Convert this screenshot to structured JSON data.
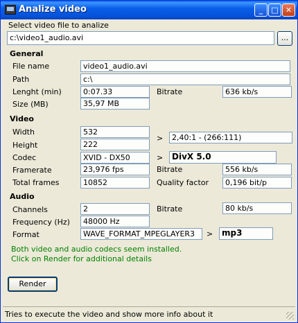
{
  "window": {
    "title": "Analize video",
    "buttons": {
      "minimize": "_",
      "maximize": "□",
      "close": "✕"
    }
  },
  "select": {
    "label": "Select video file to analize",
    "value": "c:\\video1_audio.avi",
    "browse_label": "..."
  },
  "general": {
    "header": "General",
    "file_name_label": "File name",
    "file_name": "video1_audio.avi",
    "path_label": "Path",
    "path": "c:\\",
    "length_label": "Lenght (min)",
    "length": "0:07.33",
    "bitrate_label": "Bitrate",
    "bitrate": "636 kb/s",
    "size_label": "Size (MB)",
    "size": "35,97 MB"
  },
  "video": {
    "header": "Video",
    "width_label": "Width",
    "width": "532",
    "height_label": "Height",
    "height": "222",
    "aspect_arrow": ">",
    "aspect": "2,40:1 - (266:111)",
    "codec_label": "Codec",
    "codec": "XVID - DX50",
    "codec_arrow": ">",
    "codec_name": "DivX 5.0",
    "framerate_label": "Framerate",
    "framerate": "23,976 fps",
    "bitrate_label": "Bitrate",
    "bitrate": "556 kb/s",
    "total_frames_label": "Total frames",
    "total_frames": "10852",
    "quality_label": "Quality factor",
    "quality": "0,196 bit/p"
  },
  "audio": {
    "header": "Audio",
    "channels_label": "Channels",
    "channels": "2",
    "bitrate_label": "Bitrate",
    "bitrate": "80 kb/s",
    "frequency_label": "Frequency (Hz)",
    "frequency": "48000 Hz",
    "format_label": "Format",
    "format": "WAVE_FORMAT_MPEGLAYER3",
    "format_arrow": ">",
    "format_name": "mp3"
  },
  "message": {
    "line1": "Both video and audio codecs seem installed.",
    "line2": "Click on Render for additional details"
  },
  "render_button": "Render",
  "status": "Tries to execute the video and show more info about it"
}
